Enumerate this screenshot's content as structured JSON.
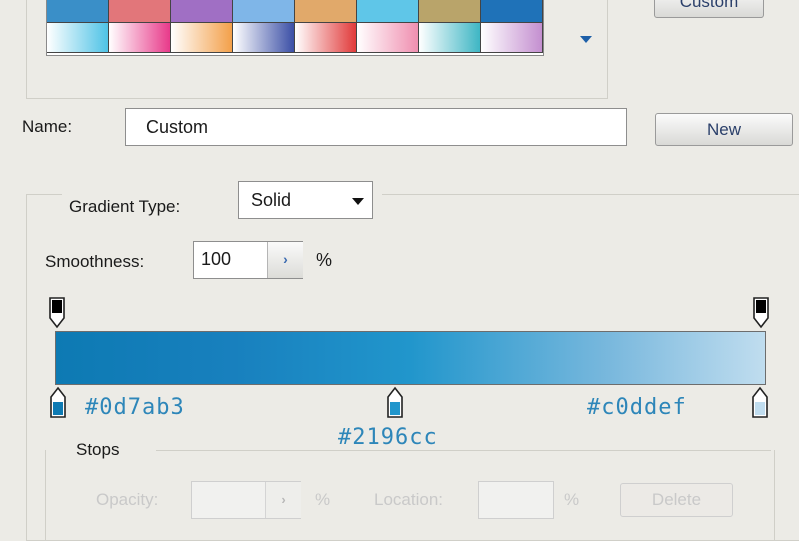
{
  "presets": {
    "swatches_row1": [
      "#3a8fc8",
      "#e2767a",
      "#a06fc4",
      "#7fb6e8",
      "#e1a96a",
      "#5fc6e8",
      "#b9a46a",
      "#1f72b8"
    ],
    "swatches_row2": [
      "linear-gradient(to right,#ffffff,#4fc3e6)",
      "linear-gradient(to right,#ffffff,#e83a8a)",
      "linear-gradient(to right,#ffffff,#f3a04a)",
      "linear-gradient(to right,#ffffff,#3b4fa6)",
      "linear-gradient(to right,#ffffff,#e13a3a)",
      "linear-gradient(to right,#ffffff,#f08fb0)",
      "linear-gradient(to right,#ffffff,#3eb6c4)",
      "linear-gradient(to right,#ffffff,#c48fd0)"
    ],
    "load_label": "Custom"
  },
  "name": {
    "label": "Name:",
    "value": "Custom",
    "new_button": "New"
  },
  "gradient": {
    "type_label": "Gradient Type:",
    "type_value": "Solid",
    "smoothness_label": "Smoothness:",
    "smoothness_value": "100",
    "smoothness_unit": "%",
    "colors": [
      "#0d7ab3",
      "#2196cc",
      "#c0ddef"
    ],
    "color_stop_labels": [
      "#0d7ab3",
      "#2196cc",
      "#c0ddef"
    ]
  },
  "stops": {
    "label": "Stops",
    "opacity_label": "Opacity:",
    "opacity_unit": "%",
    "location_label": "Location:",
    "location_unit": "%",
    "delete_label": "Delete"
  },
  "icons": {
    "stepper_glyph": "›"
  }
}
